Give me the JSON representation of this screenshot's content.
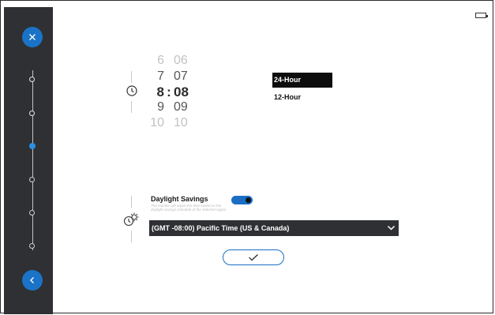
{
  "sidebar": {
    "close_icon": "close-icon",
    "back_icon": "back-arrow-icon",
    "steps": [
      "done",
      "done",
      "active",
      "pending",
      "pending",
      "pending"
    ]
  },
  "time_picker": {
    "rows": [
      {
        "hour": "6",
        "sep": "",
        "minute": "06"
      },
      {
        "hour": "7",
        "sep": "",
        "minute": "07"
      },
      {
        "hour": "8",
        "sep": ":",
        "minute": "08"
      },
      {
        "hour": "9",
        "sep": "",
        "minute": "09"
      },
      {
        "hour": "10",
        "sep": "",
        "minute": "10"
      }
    ],
    "format_options": [
      "24-Hour",
      "12-Hour"
    ],
    "selected_format": "24-Hour"
  },
  "daylight": {
    "label": "Daylight Savings",
    "description": "The monitor will adjust the time based on the daylight savings schedule of the selected region.",
    "toggle_on": true
  },
  "timezone": {
    "selected": "(GMT -08:00) Pacific Time (US & Canada)"
  },
  "colors": {
    "accent": "#1a73c7",
    "sidebar": "#2f3033"
  }
}
